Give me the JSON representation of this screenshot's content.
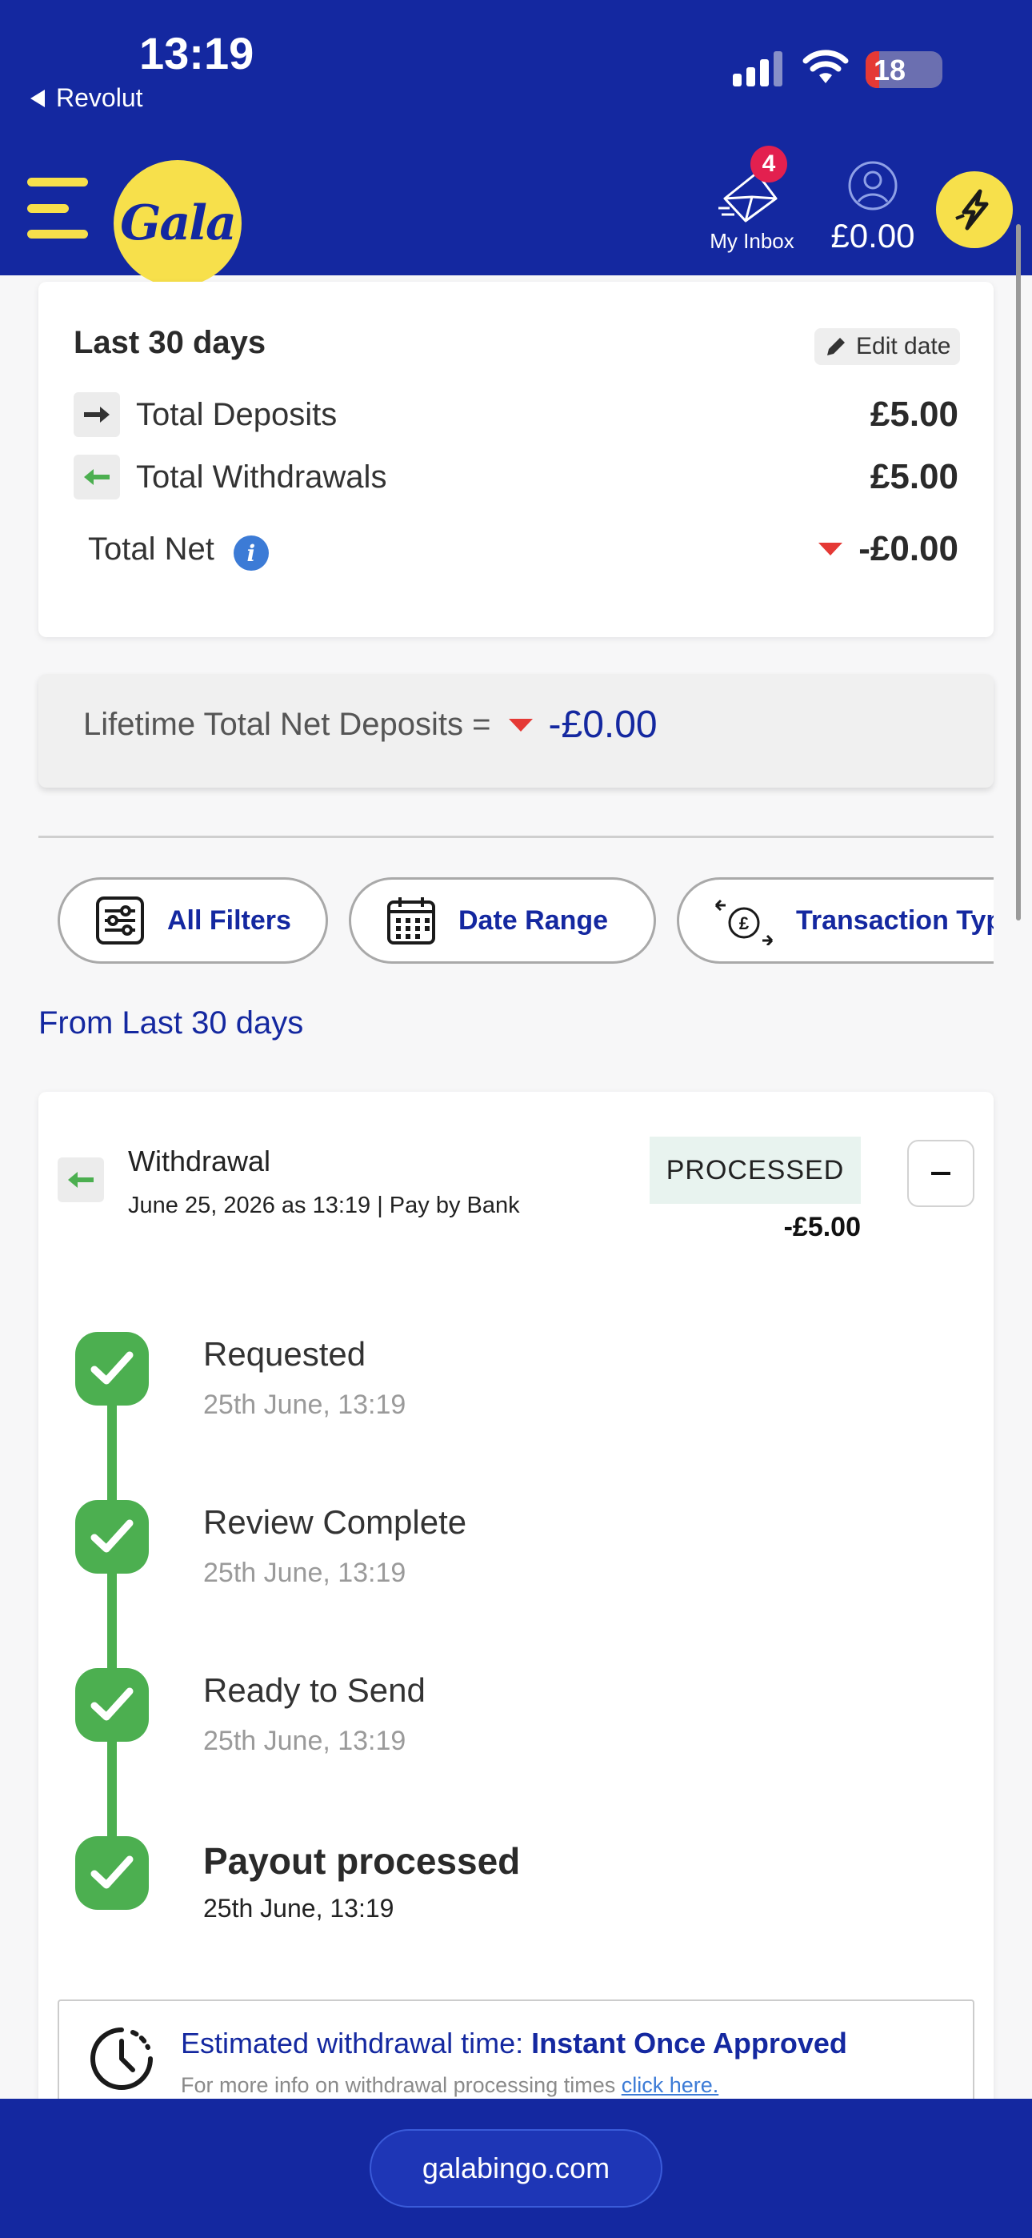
{
  "status_bar": {
    "time": "13:19",
    "back_app": "Revolut",
    "battery": "18",
    "battery_level": 0.18,
    "colors": {
      "bar": "#1428a0",
      "battery_low": "#e53935"
    }
  },
  "header": {
    "menu_icon": "hamburger-icon",
    "logo_text": "Gala",
    "inbox_label": "My Inbox",
    "inbox_count": "4",
    "balance": "£0.00",
    "brand_yellow": "#f7e04b"
  },
  "summary": {
    "title": "Last 30 days",
    "edit_label": "Edit date",
    "deposits_label": "Total Deposits",
    "deposits_value": "£5.00",
    "withdrawals_label": "Total Withdrawals",
    "withdrawals_value": "£5.00",
    "net_label": "Total Net",
    "net_value": "-£0.00"
  },
  "lifetime": {
    "label": "Lifetime Total Net Deposits =",
    "value": "-£0.00"
  },
  "filters": {
    "all_filters": "All Filters",
    "date_range": "Date Range",
    "transaction_type": "Transaction Type"
  },
  "from_label": "From Last 30 days",
  "transaction": {
    "type": "Withdrawal",
    "meta": "June 25, 2026 as 13:19 | Pay by Bank",
    "status": "PROCESSED",
    "amount": "-£5.00",
    "steps": [
      {
        "title": "Requested",
        "time": "25th June, 13:19"
      },
      {
        "title": "Review Complete",
        "time": "25th June, 13:19"
      },
      {
        "title": "Ready to Send",
        "time": "25th June, 13:19"
      },
      {
        "title": "Payout processed",
        "time": "25th June, 13:19"
      }
    ],
    "estimate": {
      "prefix": "Estimated withdrawal time: ",
      "value": "Instant Once Approved",
      "info": "For more info on withdrawal processing times ",
      "link": "click here."
    }
  },
  "browser": {
    "url": "galabingo.com"
  }
}
